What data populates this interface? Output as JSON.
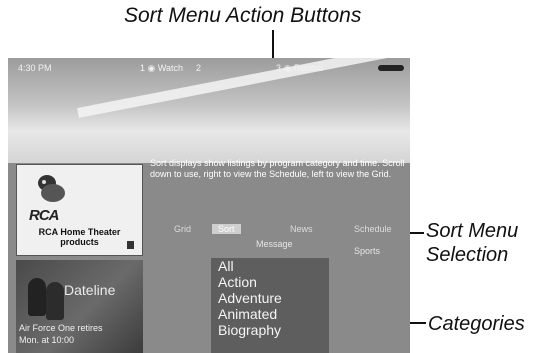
{
  "callouts": {
    "top": "Sort Menu Action Buttons",
    "selection_1": "Sort Menu",
    "selection_2": "Selection",
    "categories": "Categories"
  },
  "status_bar": {
    "time": "4:30 PM",
    "watch": "1 ◉ Watch",
    "channel_2": "2",
    "record": "3 ◉ Record"
  },
  "info_text": "Sort displays show listings by program category and time. Scroll down to use, right to view the Schedule, left to view the Grid.",
  "ad": {
    "logo": "RCA",
    "caption": "RCA Home Theater products"
  },
  "video": {
    "title": "Dateline",
    "caption_line1": "Air Force One retires",
    "caption_line2": "Mon. at 10:00"
  },
  "tabs": {
    "grid": "Grid",
    "sort": "Sort",
    "news": "News",
    "schedule": "Schedule",
    "message": "Message",
    "sports": "Sports"
  },
  "categories": [
    "All",
    "Action",
    "Adventure",
    "Animated",
    "Biography"
  ]
}
